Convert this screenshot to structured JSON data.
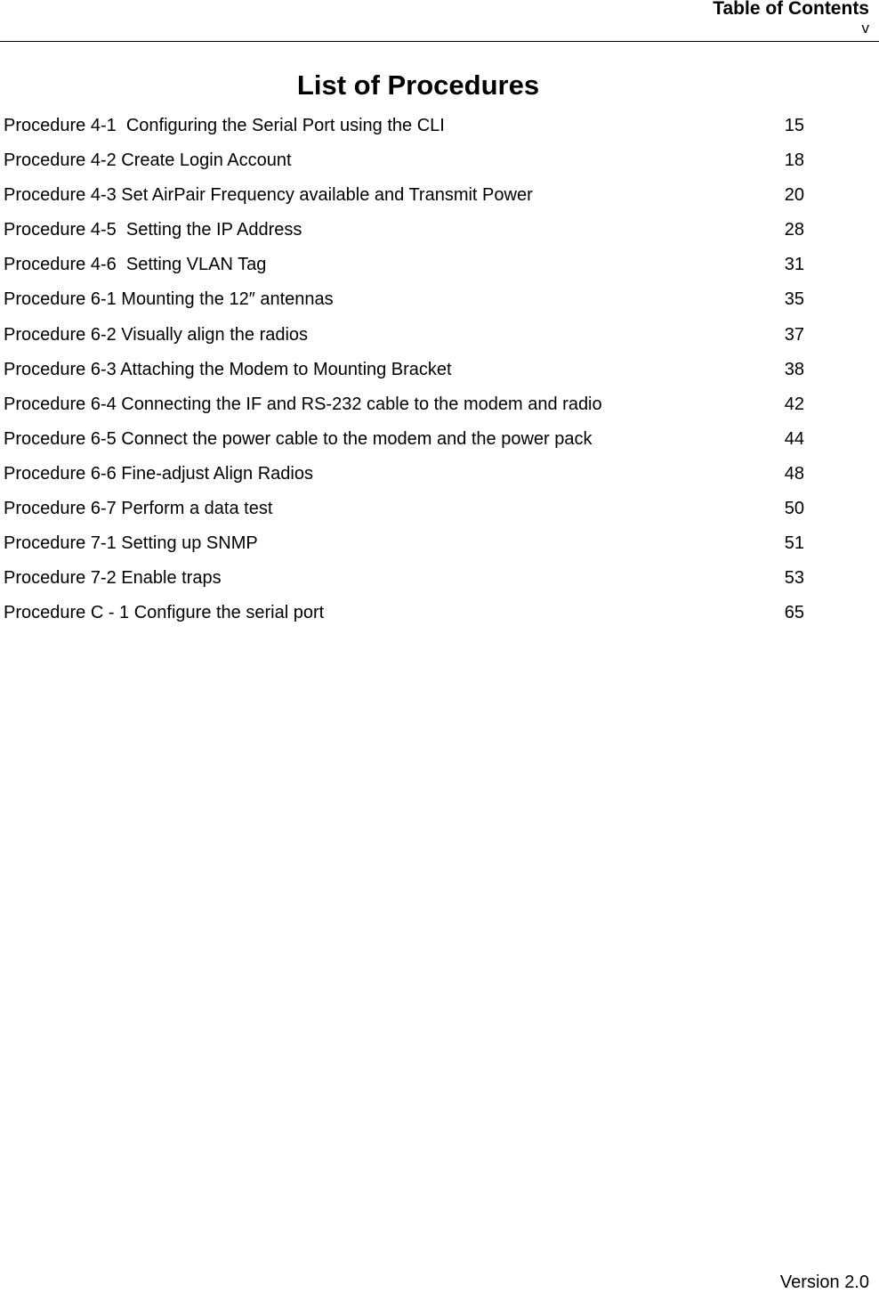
{
  "header": {
    "section_title": "Table of Contents",
    "page_number": "v"
  },
  "page_title": "List of Procedures",
  "procedures": [
    {
      "title": "Procedure 4-1  Configuring the Serial Port using the CLI",
      "page": "15"
    },
    {
      "title": "Procedure 4-2 Create Login Account",
      "page": "18"
    },
    {
      "title": "Procedure 4-3 Set AirPair Frequency available and Transmit Power",
      "page": "20"
    },
    {
      "title": "Procedure 4-5  Setting the IP Address",
      "page": "28"
    },
    {
      "title": "Procedure 4-6  Setting VLAN Tag",
      "page": "31"
    },
    {
      "title": "Procedure 6-1 Mounting the 12″ antennas",
      "page": "35"
    },
    {
      "title": "Procedure 6-2 Visually align the radios",
      "page": "37"
    },
    {
      "title": "Procedure 6-3 Attaching the Modem to Mounting Bracket",
      "page": "38"
    },
    {
      "title": "Procedure 6-4 Connecting the IF and RS-232 cable to the modem and radio",
      "page": "42"
    },
    {
      "title": "Procedure 6-5 Connect the power cable to the modem and the power pack",
      "page": "44"
    },
    {
      "title": "Procedure 6-6 Fine-adjust Align Radios",
      "page": "48"
    },
    {
      "title": "Procedure 6-7 Perform a data test",
      "page": "50"
    },
    {
      "title": "Procedure 7-1 Setting up SNMP",
      "page": "51"
    },
    {
      "title": "Procedure 7-2 Enable traps",
      "page": "53"
    },
    {
      "title": "Procedure C - 1 Configure the serial port",
      "page": "65"
    }
  ],
  "footer": {
    "version": "Version 2.0"
  }
}
